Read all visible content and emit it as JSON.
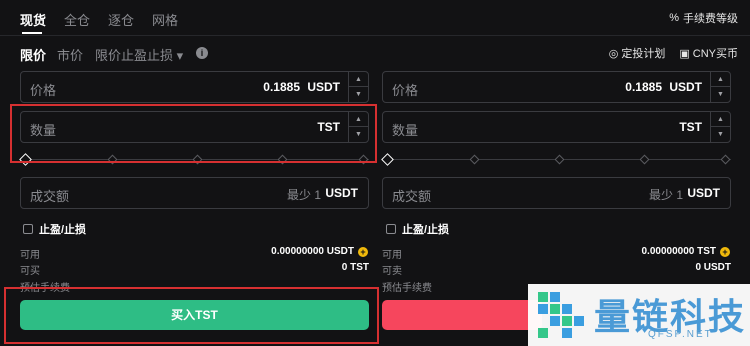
{
  "tabs": [
    {
      "label": "现货",
      "active": true
    },
    {
      "label": "全仓",
      "active": false
    },
    {
      "label": "逐仓",
      "active": false
    },
    {
      "label": "网格",
      "active": false
    }
  ],
  "fee_level": {
    "label": "手续费等级",
    "icon": "percent-icon"
  },
  "order_types": [
    {
      "label": "限价",
      "active": true
    },
    {
      "label": "市价",
      "active": false
    },
    {
      "label": "限价止盈止损 ▾",
      "active": false
    }
  ],
  "actions": {
    "recurring": {
      "label": "定投计划",
      "icon": "recurring-icon"
    },
    "cny": {
      "label": "CNY买币",
      "icon": "wallet-icon"
    }
  },
  "buy": {
    "price": {
      "label": "价格",
      "value": "0.1885",
      "unit": "USDT"
    },
    "amount": {
      "label": "数量",
      "value": "",
      "unit": "TST"
    },
    "total": {
      "label": "成交额",
      "min": "最少 1",
      "unit": "USDT"
    },
    "tpsl_label": "止盈/止损",
    "available_label": "可用",
    "available_value": "0.00000000 USDT",
    "max_label": "可买",
    "max_value": "0 TST",
    "fee_label": "预估手续费",
    "button_label": "买入TST"
  },
  "sell": {
    "price": {
      "label": "价格",
      "value": "0.1885",
      "unit": "USDT"
    },
    "amount": {
      "label": "数量",
      "value": "",
      "unit": "TST"
    },
    "total": {
      "label": "成交额",
      "min": "最少 1",
      "unit": "USDT"
    },
    "tpsl_label": "止盈/止损",
    "available_label": "可用",
    "available_value": "0.00000000 TST",
    "max_label": "可卖",
    "max_value": "0 USDT",
    "fee_label": "预估手续费"
  },
  "watermark": {
    "title": "量链科技",
    "subtitle": "QFSP.NET"
  },
  "colors": {
    "buy": "#2ebd85",
    "sell": "#f6465d",
    "highlight": "#d63031",
    "accent": "#f0b90b"
  }
}
